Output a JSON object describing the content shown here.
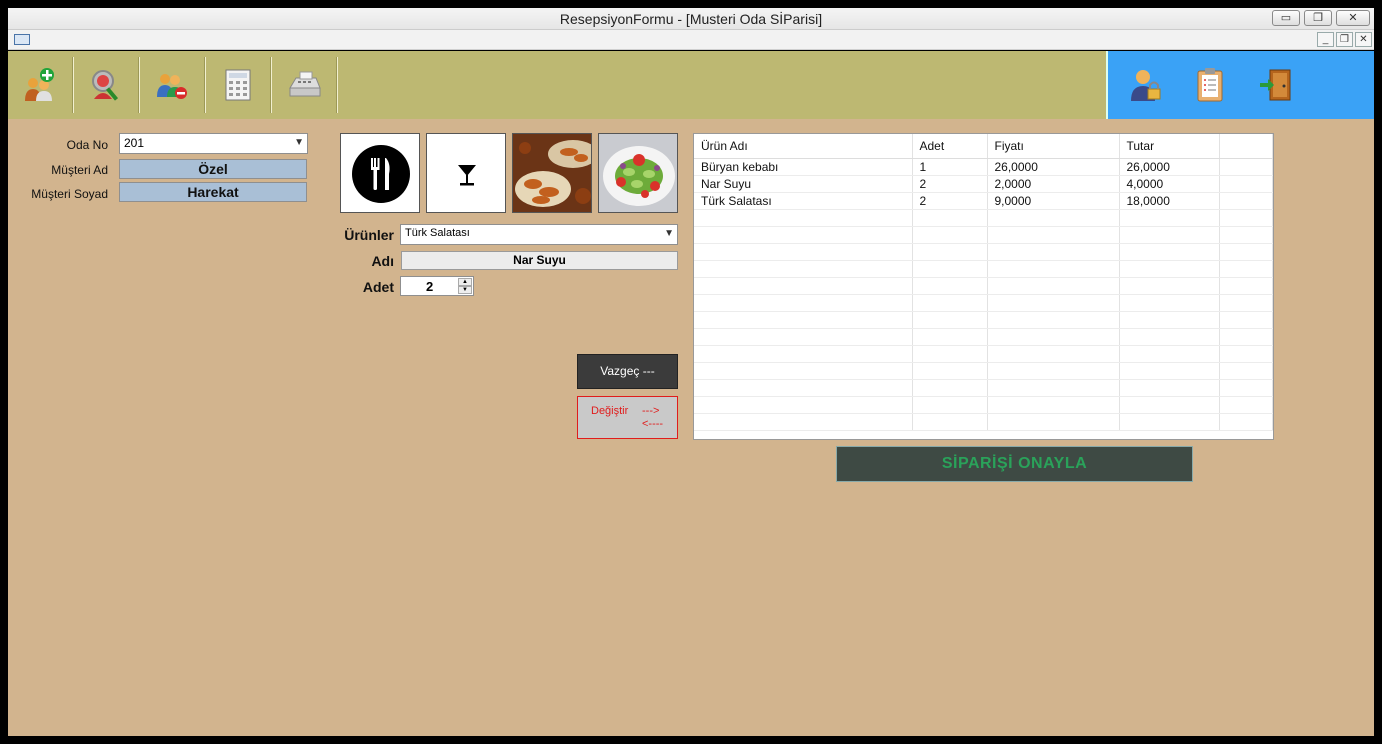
{
  "window": {
    "title": "ResepsiyonFormu - [Musteri Oda SİParisi]"
  },
  "window_buttons": {
    "minimize": "▭",
    "restore": "❐",
    "close": "✕"
  },
  "mdi_buttons": {
    "minimize": "_",
    "restore": "❐",
    "close": "✕"
  },
  "toolbar": {
    "icons": [
      "add-customer-icon",
      "search-customer-icon",
      "remove-customer-icon",
      "calculator-icon",
      "cash-register-icon"
    ]
  },
  "side_toolbar": {
    "icons": [
      "user-lock-icon",
      "clipboard-icon",
      "exit-door-icon"
    ]
  },
  "form": {
    "oda_no_label": "Oda No",
    "oda_no_value": "201",
    "musteri_ad_label": "Müşteri Ad",
    "musteri_ad_value": "Özel",
    "musteri_soyad_label": "Müşteri Soyad",
    "musteri_soyad_value": "Harekat"
  },
  "order": {
    "urunler_label": "Ürünler",
    "urunler_value": "Türk Salatası",
    "adi_label": "Adı",
    "adi_value": "Nar Suyu",
    "adet_label": "Adet",
    "adet_value": "2"
  },
  "buttons": {
    "vazgec": "Vazgeç    ---",
    "degistir": "Değiştir",
    "degistir_right": "--->",
    "degistir_left": "<----",
    "onayla": "SİPARİŞİ  ONAYLA"
  },
  "grid": {
    "columns": [
      "Ürün Adı",
      "Adet",
      "Fiyatı",
      "Tutar"
    ],
    "rows": [
      [
        "Büryan kebabı",
        "1",
        "26,0000",
        "26,0000"
      ],
      [
        "Nar Suyu",
        "2",
        "2,0000",
        "4,0000"
      ],
      [
        "Türk Salatası",
        "2",
        "9,0000",
        "18,0000"
      ]
    ]
  }
}
